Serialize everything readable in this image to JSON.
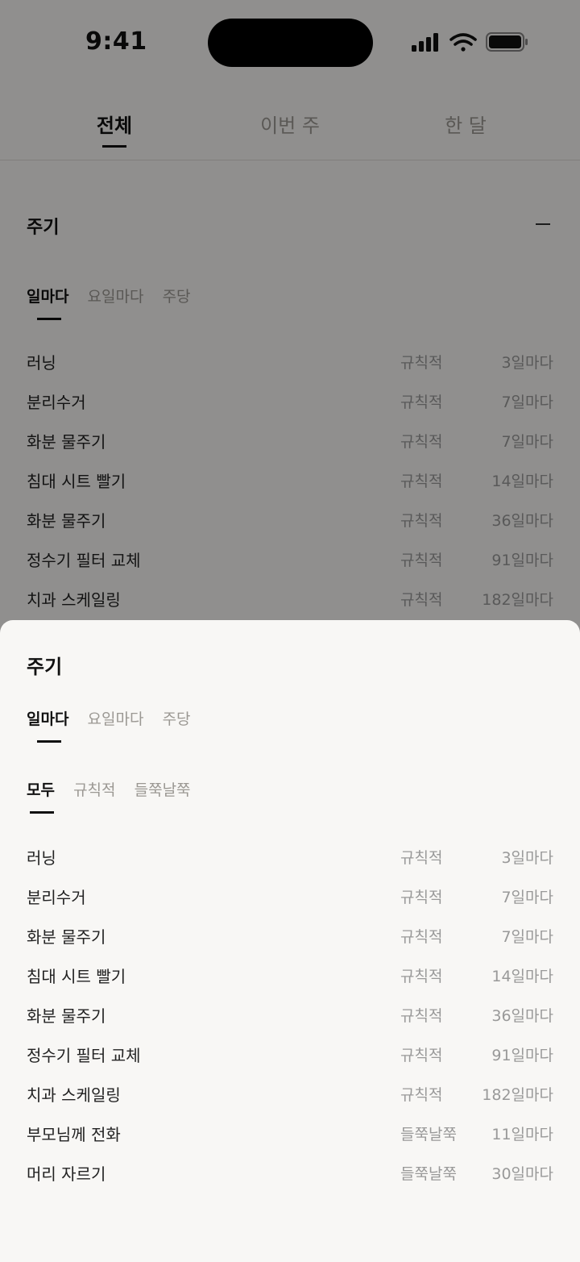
{
  "status_bar": {
    "time": "9:41",
    "icons": [
      "cellular-signal-icon",
      "wifi-icon",
      "battery-icon"
    ]
  },
  "top_tabs": {
    "items": [
      {
        "label": "전체",
        "active": true
      },
      {
        "label": "이번 주",
        "active": false
      },
      {
        "label": "한 달",
        "active": false
      }
    ]
  },
  "section": {
    "title": "주기",
    "collapse_icon": "minus-icon",
    "period_tabs": [
      {
        "label": "일마다",
        "active": true
      },
      {
        "label": "요일마다",
        "active": false
      },
      {
        "label": "주당",
        "active": false
      }
    ],
    "items": [
      {
        "name": "러닝",
        "kind": "규칙적",
        "freq": "3일마다"
      },
      {
        "name": "분리수거",
        "kind": "규칙적",
        "freq": "7일마다"
      },
      {
        "name": "화분 물주기",
        "kind": "규칙적",
        "freq": "7일마다"
      },
      {
        "name": "침대 시트 빨기",
        "kind": "규칙적",
        "freq": "14일마다"
      },
      {
        "name": "화분 물주기",
        "kind": "규칙적",
        "freq": "36일마다"
      },
      {
        "name": "정수기 필터 교체",
        "kind": "규칙적",
        "freq": "91일마다"
      },
      {
        "name": "치과 스케일링",
        "kind": "규칙적",
        "freq": "182일마다"
      }
    ]
  },
  "sheet": {
    "title": "주기",
    "period_tabs": [
      {
        "label": "일마다",
        "active": true
      },
      {
        "label": "요일마다",
        "active": false
      },
      {
        "label": "주당",
        "active": false
      }
    ],
    "filter_tabs": [
      {
        "label": "모두",
        "active": true
      },
      {
        "label": "규칙적",
        "active": false
      },
      {
        "label": "들쭉날쭉",
        "active": false
      }
    ],
    "items": [
      {
        "name": "러닝",
        "kind": "규칙적",
        "freq": "3일마다"
      },
      {
        "name": "분리수거",
        "kind": "규칙적",
        "freq": "7일마다"
      },
      {
        "name": "화분 물주기",
        "kind": "규칙적",
        "freq": "7일마다"
      },
      {
        "name": "침대 시트 빨기",
        "kind": "규칙적",
        "freq": "14일마다"
      },
      {
        "name": "화분 물주기",
        "kind": "규칙적",
        "freq": "36일마다"
      },
      {
        "name": "정수기 필터 교체",
        "kind": "규칙적",
        "freq": "91일마다"
      },
      {
        "name": "치과 스케일링",
        "kind": "규칙적",
        "freq": "182일마다"
      },
      {
        "name": "부모님께 전화",
        "kind": "들쭉날쭉",
        "freq": "11일마다"
      },
      {
        "name": "머리 자르기",
        "kind": "들쭉날쭉",
        "freq": "30일마다"
      }
    ]
  }
}
